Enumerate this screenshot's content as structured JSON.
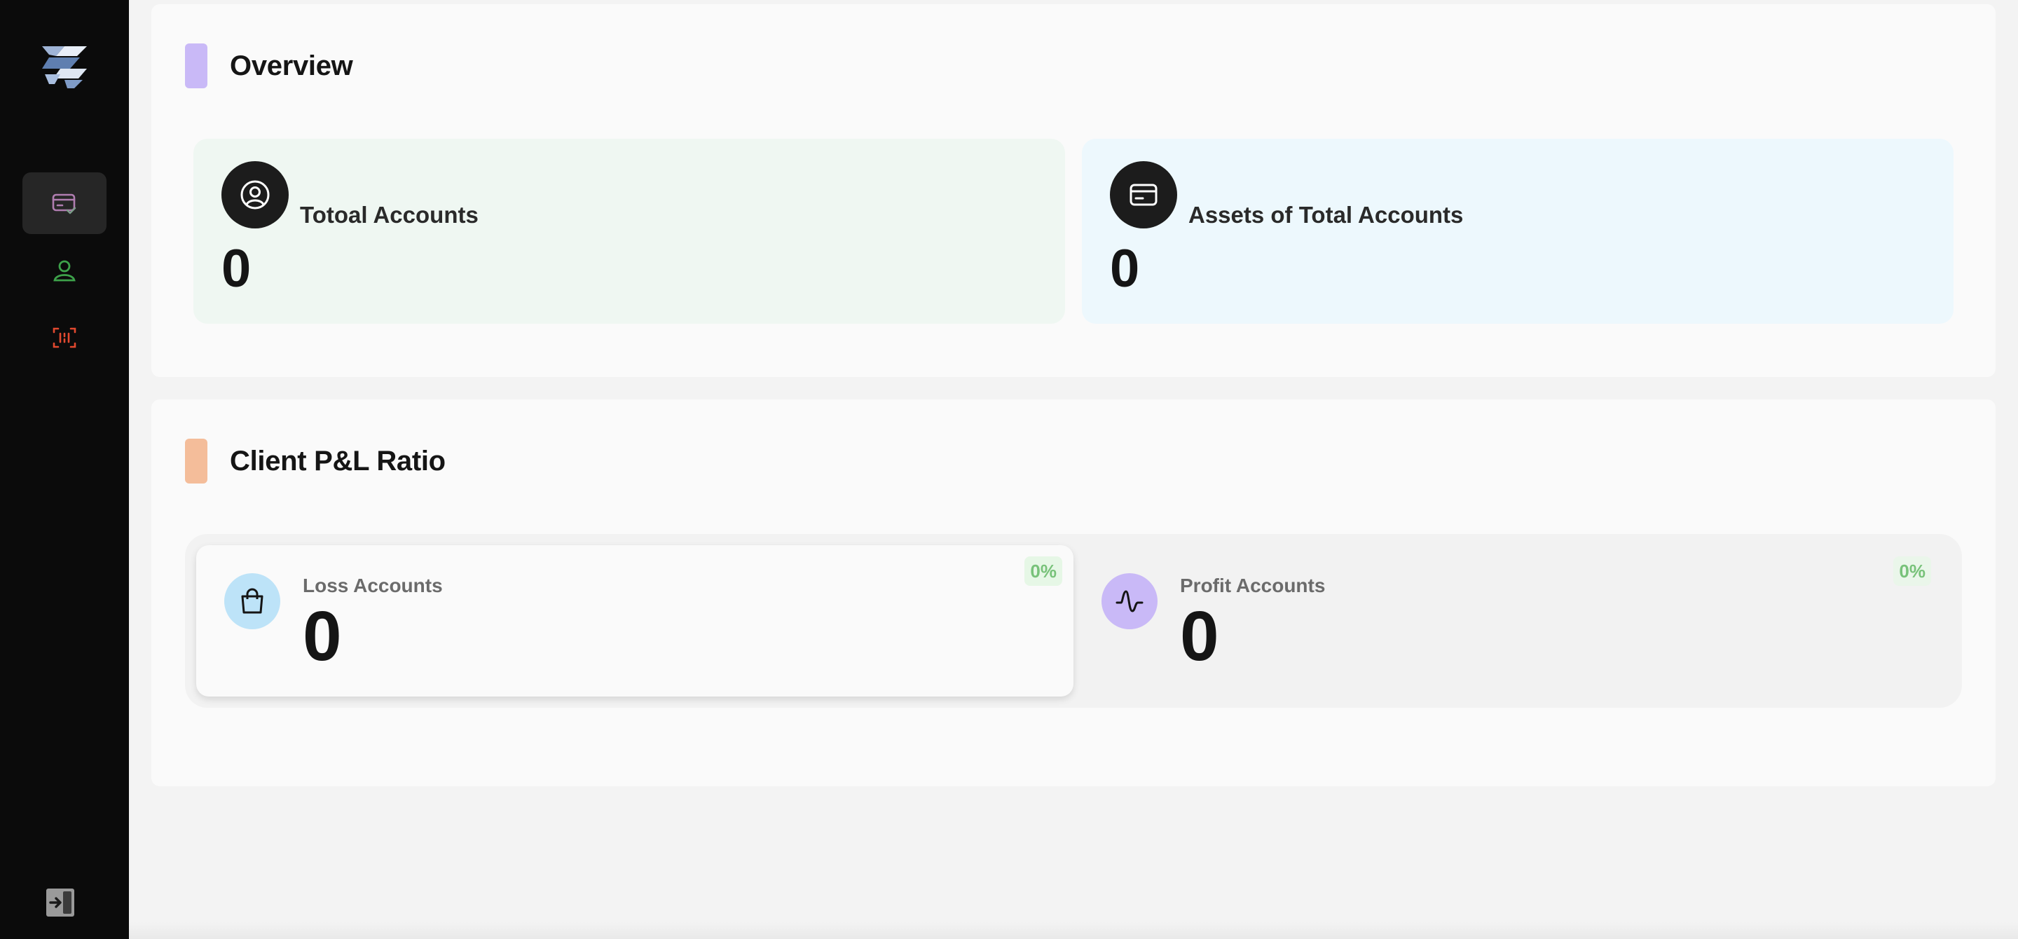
{
  "sidebar": {
    "nav": [
      {
        "icon": "credit-card-check-icon",
        "color": "#b07db0",
        "active": true
      },
      {
        "icon": "user-icon",
        "color": "#3da14a",
        "active": false
      },
      {
        "icon": "scan-icon",
        "color": "#e2492f",
        "active": false
      }
    ],
    "logout_icon": "logout-icon"
  },
  "overview": {
    "title": "Overview",
    "accent": "#c9b9f7",
    "cards": [
      {
        "label": "Totoal Accounts",
        "value": "0",
        "icon": "user-circle-icon",
        "bg": "#eff7f2"
      },
      {
        "label": "Assets of Total Accounts",
        "value": "0",
        "icon": "card-icon",
        "bg": "#edf8fd"
      }
    ]
  },
  "pl": {
    "title": "Client P&L Ratio",
    "accent": "#f4bd9a",
    "cards": [
      {
        "label": "Loss Accounts",
        "value": "0",
        "pct": "0%",
        "icon": "shopping-bag-icon",
        "icon_bg": "#bde3f8"
      },
      {
        "label": "Profit Accounts",
        "value": "0",
        "pct": "0%",
        "icon": "activity-icon",
        "icon_bg": "#c9b9f7"
      }
    ]
  }
}
